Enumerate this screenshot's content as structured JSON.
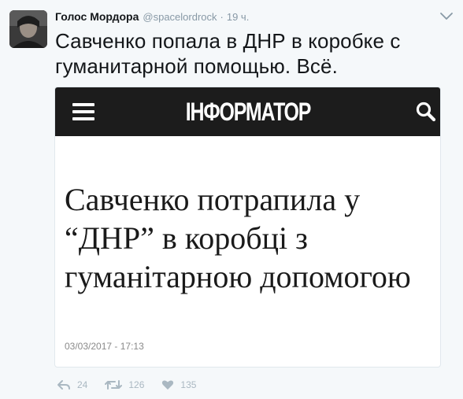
{
  "tweet": {
    "author_name": "Голос Мордора",
    "author_handle": "@spacelordrock",
    "separator": "·",
    "timestamp": "19 ч.",
    "text": "Савченко попала в ДНР в коробке с гуманитарной помощью. Всё."
  },
  "card": {
    "site_logo": "ІНФОРМАТОР",
    "headline": "Савченко потрапила у “ДНР” в коробці з гуманітарною допомогою",
    "date": "03/03/2017 - 17:13"
  },
  "actions": {
    "reply_count": "24",
    "retweet_count": "126",
    "like_count": "135"
  },
  "colors": {
    "background": "#f5f8fa",
    "muted": "#8899a6",
    "card_bar": "#1c1c1c",
    "action_icon": "#aab8c2"
  }
}
